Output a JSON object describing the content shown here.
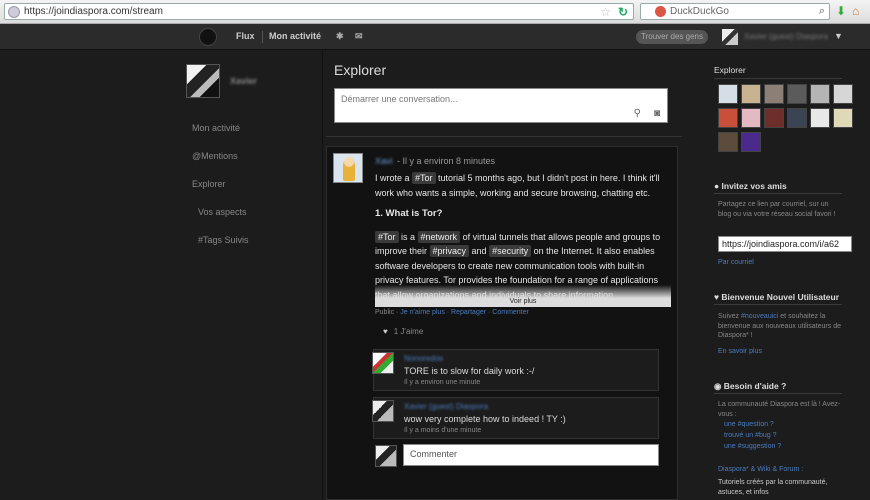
{
  "browser": {
    "url": "https://joindiaspora.com/stream",
    "search_engine": "DuckDuckGo"
  },
  "nav": {
    "stream": "Flux",
    "my_activity": "Mon activité",
    "search_placeholder": "Trouver des gens",
    "username": "Xavier (guest) Diaspora"
  },
  "sidebar": {
    "profile_name": "Xavier",
    "items": [
      {
        "label": "Mon activité"
      },
      {
        "label": "@Mentions"
      },
      {
        "label": "Explorer"
      },
      {
        "label": "Vos aspects"
      },
      {
        "label": "#Tags Suivis"
      }
    ]
  },
  "main": {
    "title": "Explorer",
    "publisher_placeholder": "Démarrer une conversation...",
    "post": {
      "author": "Xavi",
      "time": "- Il y a environ 8 minutes",
      "p1_a": "I wrote a ",
      "p1_tag": "#Tor",
      "p1_b": " tutorial 5 months ago, but I didn't post in here. I think it'll work who wants a simple, working and secure browsing, chatting etc.",
      "heading": "1. What is Tor?",
      "p2_tag1": "#Tor",
      "p2_a": " is a ",
      "p2_tag2": "#network",
      "p2_b": " of virtual tunnels that allows people and groups to improve their ",
      "p2_tag3": "#privacy",
      "p2_c": " and ",
      "p2_tag4": "#security",
      "p2_d": " on the Internet. It also enables software developers to create new communication tools with built-in privacy features. Tor provides the foundation for a range of applications that allow organizations and individuals to share information",
      "voir_plus": "Voir plus",
      "meta_public": "Public · ",
      "meta_links": "Je n'aime plus · Repartager · Commenter",
      "likes": "1 J'aime"
    },
    "comments": [
      {
        "author": "Nonoredos",
        "text": "TORE is to slow for daily work :-/",
        "time": "Il y a environ une minute"
      },
      {
        "author": "Xavier (guest) Diaspora",
        "text": "wow very complete how to indeed ! TY :)",
        "time": "Il y a moins d'une minute"
      }
    ],
    "comment_placeholder": "Commenter"
  },
  "right": {
    "explorer_title": "Explorer",
    "invite_title": "Invitez vos amis",
    "invite_text": "Partagez ce lien par courriel, sur un blog ou via votre réseau social favori !",
    "invite_link": "https://joindiaspora.com/i/a62",
    "invite_email": "Par courriel",
    "welcome_title": "Bienvenue Nouvel Utilisateur",
    "welcome_text_a": "Suivez ",
    "welcome_tag": "#nouveauici",
    "welcome_text_b": " et souhaitez la bienvenue aux nouveaux utilisateurs de Diaspora* !",
    "learn_more": "En savoir plus",
    "help_title": "Besoin d'aide ?",
    "help_text": "La communauté Diaspora est là ! Avez-vous :",
    "help_q1": "une #question ?",
    "help_q2": "trouvé un #bug ?",
    "help_q3": "une #suggestion ?",
    "help_links_a": "Diaspora* & Wiki & Forum :",
    "help_links_b": "Tutoriels créés par la communauté, astuces, et infos"
  },
  "colors": {
    "background": "#1c1c1c",
    "link": "#4a7cbf",
    "tag_bg": "#3a3a3a"
  }
}
